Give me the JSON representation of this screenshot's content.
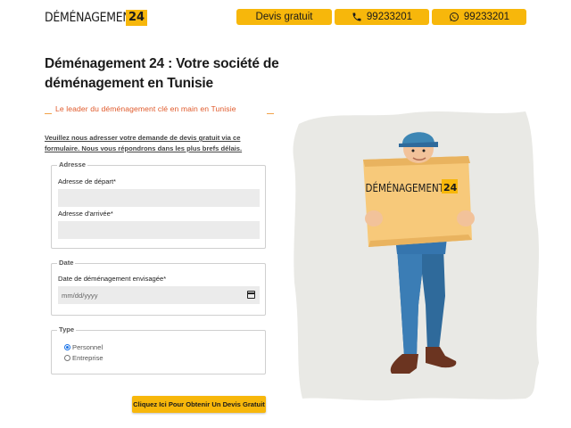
{
  "header": {
    "logo_text": "DÉMÉNAGEMENT",
    "logo_number": "24",
    "devis_label": "Devis gratuit",
    "phone_label": "99233201",
    "whatsapp_label": "99233201"
  },
  "hero": {
    "title": "Déménagement 24 : Votre société de déménagement en Tunisie",
    "subtitle": "Le leader du déménagement clé en main en Tunisie",
    "intro": "Veuillez nous adresser votre demande de devis gratuit via ce formulaire. Nous vous répondrons dans les plus brefs délais."
  },
  "form": {
    "adresse": {
      "legend": "Adresse",
      "depart_label": "Adresse de départ*",
      "depart_value": "",
      "arrivee_label": "Adresse d'arrivée*",
      "arrivee_value": ""
    },
    "date": {
      "legend": "Date",
      "label": "Date de déménagement envisagée*",
      "placeholder": "mm/dd/yyyy"
    },
    "type": {
      "legend": "Type",
      "options": [
        "Personnel",
        "Entreprise"
      ],
      "selected": "Personnel"
    },
    "submit_label": "Cliquez Ici Pour Obtenir Un Devis Gratuit"
  },
  "illustration": {
    "box_text": "DÉMÉNAGEMENT",
    "box_number": "24"
  },
  "colors": {
    "accent": "#f7b70b",
    "subtitle": "#e05a2b",
    "input_bg": "#ebebeb"
  }
}
